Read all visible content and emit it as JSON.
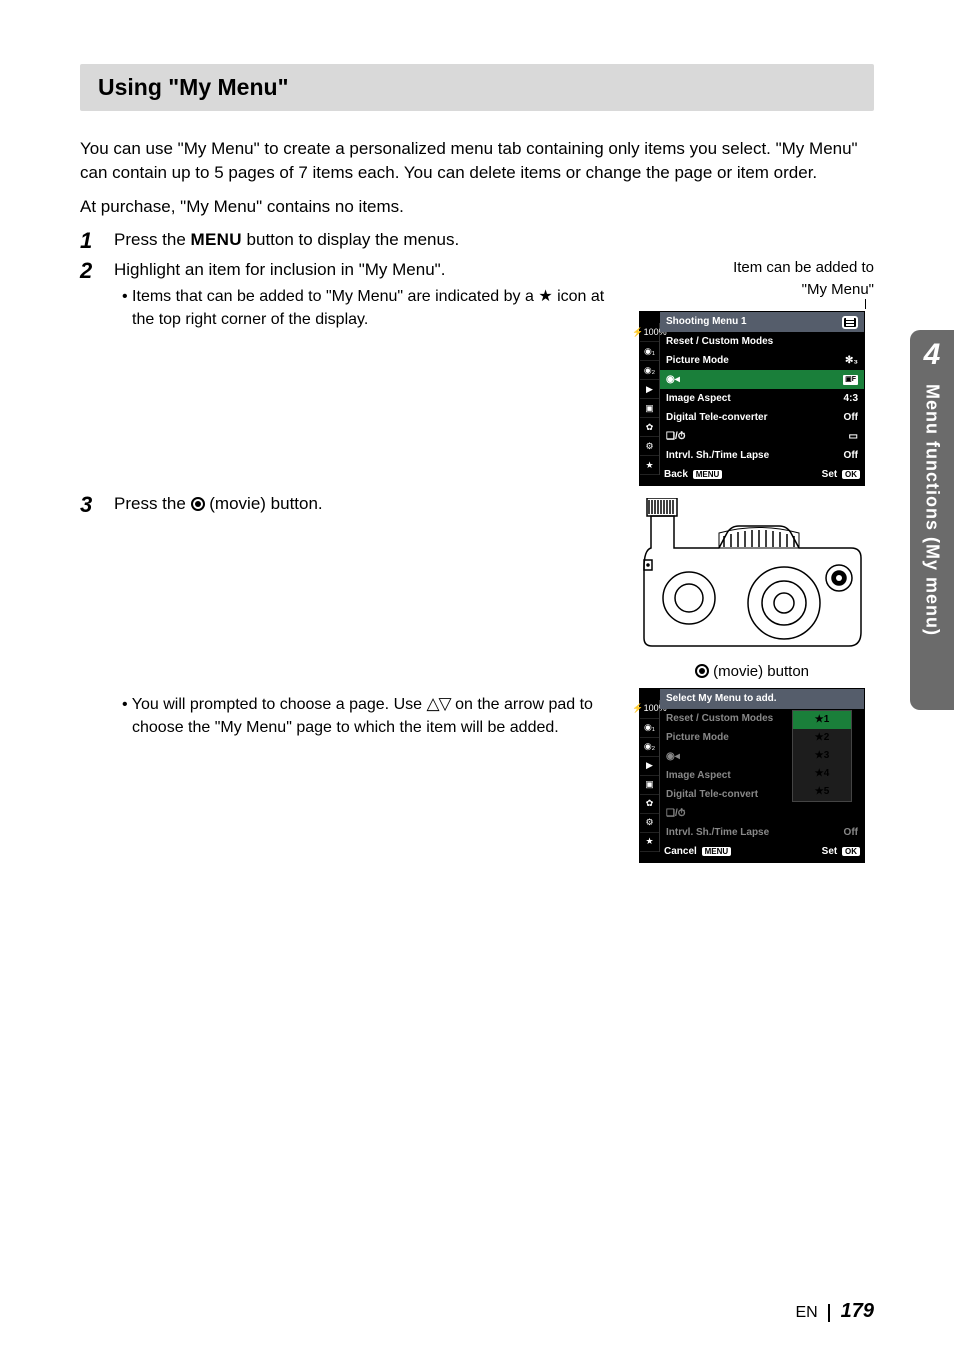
{
  "title": "Using \"My Menu\"",
  "intro1": "You can use \"My Menu\" to create a personalized menu tab containing only items you select. \"My Menu\" can contain up to 5 pages of 7 items each. You can delete items or change the page or item order.",
  "intro2": "At purchase, \"My Menu\" contains no items.",
  "step1_pre": "Press the ",
  "menu_word": "MENU",
  "step1_post": " button to display the menus.",
  "step2": "Highlight an item for inclusion in \"My Menu\".",
  "step2_sub_pre": "Items that can be added to \"My Menu\" are indicated by a ",
  "step2_sub_post": " icon at the top right corner of the display.",
  "caption_top1": "Item can be added to",
  "caption_top2": "\"My Menu\"",
  "step3_pre": "Press the ",
  "step3_post": " (movie) button.",
  "movie_caption": " (movie) button",
  "step3_sub_pre": "You will prompted to choose a page. Use ",
  "step3_sub_post": " on the arrow pad to choose the \"My Menu\" page to which the item will be added.",
  "cam1": {
    "title": "Shooting Menu 1",
    "rows": [
      {
        "label": "Reset / Custom Modes",
        "val": ""
      },
      {
        "label": "Picture Mode",
        "val": "✻₃"
      },
      {
        "label": "◉◂",
        "val": "▣F"
      },
      {
        "label": "Image Aspect",
        "val": "4:3"
      },
      {
        "label": "Digital Tele-converter",
        "val": "Off"
      },
      {
        "label": "❏/⏱",
        "val": "▭"
      },
      {
        "label": "Intrvl. Sh./Time Lapse",
        "val": "Off"
      }
    ],
    "footer_left": "Back",
    "footer_left_pill": "MENU",
    "footer_right": "Set",
    "footer_right_pill": "OK"
  },
  "cam2": {
    "title": "Select My Menu to add.",
    "rows": [
      {
        "label": "Reset / Custom Modes",
        "val": ""
      },
      {
        "label": "Picture Mode",
        "val": ""
      },
      {
        "label": "◉◂",
        "val": ""
      },
      {
        "label": "Image Aspect",
        "val": ""
      },
      {
        "label": "Digital Tele-convert",
        "val": ""
      },
      {
        "label": "❏/⏱",
        "val": ""
      },
      {
        "label": "Intrvl. Sh./Time Lapse",
        "val": "Off"
      }
    ],
    "overlay": [
      "★1",
      "★2",
      "★3",
      "★4",
      "★5"
    ],
    "footer_left": "Cancel",
    "footer_left_pill": "MENU",
    "footer_right": "Set",
    "footer_right_pill": "OK"
  },
  "side_icons": [
    "⚡100%",
    "◉₁",
    "◉₂",
    "▶",
    "▣",
    "✿",
    "⚙",
    "★"
  ],
  "side_tab_num": "4",
  "side_tab_text": "Menu functions (My menu)",
  "footer_lang": "EN",
  "page_num": "179"
}
